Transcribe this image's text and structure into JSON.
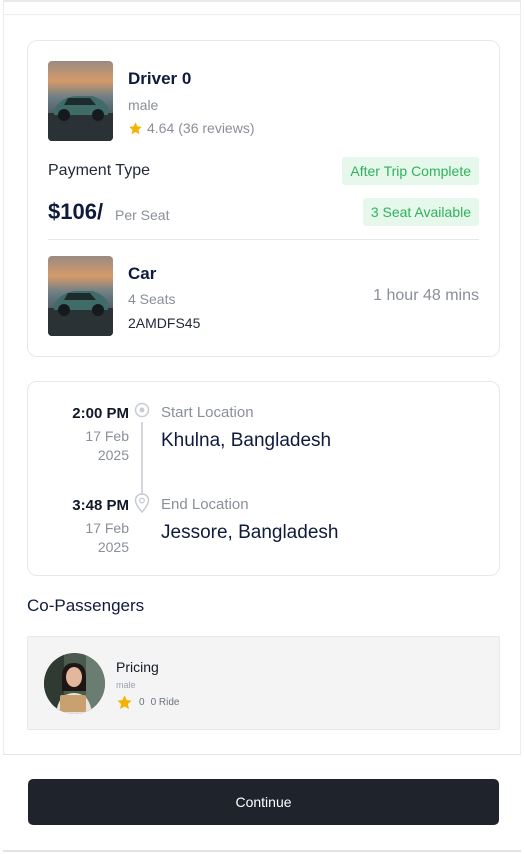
{
  "driver": {
    "name": "Driver 0",
    "gender": "male",
    "rating": "4.64",
    "reviews": "(36 reviews)"
  },
  "payment": {
    "label": "Payment Type",
    "type_badge": "After Trip Complete",
    "price": "$106/",
    "per_seat": "Per Seat",
    "seats_badge": "3 Seat Available"
  },
  "car": {
    "name": "Car",
    "seats": "4 Seats",
    "plate": "2AMDFS45",
    "duration": "1 hour 48 mins"
  },
  "route": {
    "start": {
      "time": "2:00 PM",
      "date_day": "17 Feb",
      "date_year": "2025",
      "label": "Start Location",
      "place": "Khulna, Bangladesh"
    },
    "end": {
      "time": "3:48 PM",
      "date_day": "17 Feb",
      "date_year": "2025",
      "label": "End Location",
      "place": "Jessore, Bangladesh"
    }
  },
  "co_passengers": {
    "title": "Co-Passengers",
    "items": [
      {
        "name": "Pricing",
        "gender": "male",
        "rating": "0",
        "rides": "0 Ride"
      }
    ]
  },
  "footer": {
    "continue_label": "Continue"
  },
  "colors": {
    "accent_green": "#2fb35a",
    "badge_bg": "#e6f7ec",
    "star": "#f5b301",
    "button_bg": "#1f242c",
    "title_navy": "#0f1b3d"
  },
  "icons": [
    "star-icon",
    "start-pin-icon",
    "end-pin-icon"
  ]
}
